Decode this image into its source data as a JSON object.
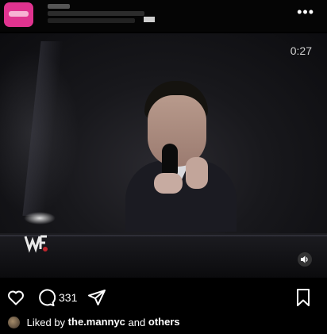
{
  "post": {
    "video_time": "0:27",
    "more_menu": "•••",
    "comment_count": "331",
    "liked_by_prefix": "Liked by",
    "liked_by_user": "the.mannyc",
    "liked_by_and": "and",
    "liked_by_others": "others"
  },
  "icons": {
    "more": "more-options-icon",
    "like": "heart-icon",
    "comment": "comment-bubble-icon",
    "share": "paper-plane-icon",
    "save": "bookmark-icon",
    "sound": "speaker-icon"
  },
  "colors": {
    "background": "#000000",
    "text": "#ffffff",
    "avatar_accent": "#e0338f"
  }
}
